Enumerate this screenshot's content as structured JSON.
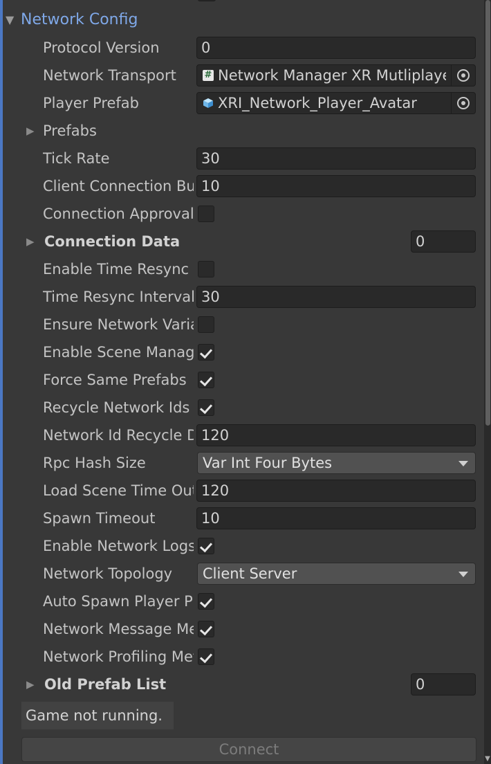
{
  "header": {
    "title": "Network Config"
  },
  "fields": {
    "protocol_version": {
      "label": "Protocol Version",
      "value": "0"
    },
    "network_transport": {
      "label": "Network Transport",
      "value": "Network Manager XR Mutliplayer",
      "icon": "script-hash-icon"
    },
    "player_prefab": {
      "label": "Player Prefab",
      "value": "XRI_Network_Player_Avatar",
      "icon": "prefab-cube-icon"
    },
    "prefabs": {
      "label": "Prefabs"
    },
    "tick_rate": {
      "label": "Tick Rate",
      "value": "30"
    },
    "client_connection_buffer": {
      "label": "Client Connection Buffer Timeout",
      "value": "10"
    },
    "connection_approval": {
      "label": "Connection Approval",
      "checked": false
    },
    "connection_data": {
      "label": "Connection Data",
      "value": "0"
    },
    "enable_time_resync": {
      "label": "Enable Time Resync",
      "checked": false
    },
    "time_resync_interval": {
      "label": "Time Resync Interval",
      "value": "30"
    },
    "ensure_network_variable": {
      "label": "Ensure Network Variable Length Safety",
      "checked": false
    },
    "enable_scene_management": {
      "label": "Enable Scene Management",
      "checked": true
    },
    "force_same_prefabs": {
      "label": "Force Same Prefabs",
      "checked": true
    },
    "recycle_network_ids": {
      "label": "Recycle Network Ids",
      "checked": true
    },
    "network_id_recycle_delay": {
      "label": "Network Id Recycle Delay",
      "value": "120"
    },
    "rpc_hash_size": {
      "label": "Rpc Hash Size",
      "value": "Var Int Four Bytes"
    },
    "load_scene_timeout": {
      "label": "Load Scene Time Out",
      "value": "120"
    },
    "spawn_timeout": {
      "label": "Spawn Timeout",
      "value": "10"
    },
    "enable_network_logs": {
      "label": "Enable Network Logs",
      "checked": true
    },
    "network_topology": {
      "label": "Network Topology",
      "value": "Client Server"
    },
    "auto_spawn_player": {
      "label": "Auto Spawn Player Prefab",
      "checked": true
    },
    "network_message_metrics": {
      "label": "Network Message Metrics",
      "checked": true
    },
    "network_profiling_metrics": {
      "label": "Network Profiling Metrics",
      "checked": true
    },
    "old_prefab_list": {
      "label": "Old Prefab List",
      "value": "0"
    }
  },
  "status": {
    "text": "Game not running."
  },
  "connect": {
    "label": "Connect"
  },
  "colors": {
    "accent": "#7fa8e8",
    "background": "#383838",
    "field": "#292929"
  }
}
